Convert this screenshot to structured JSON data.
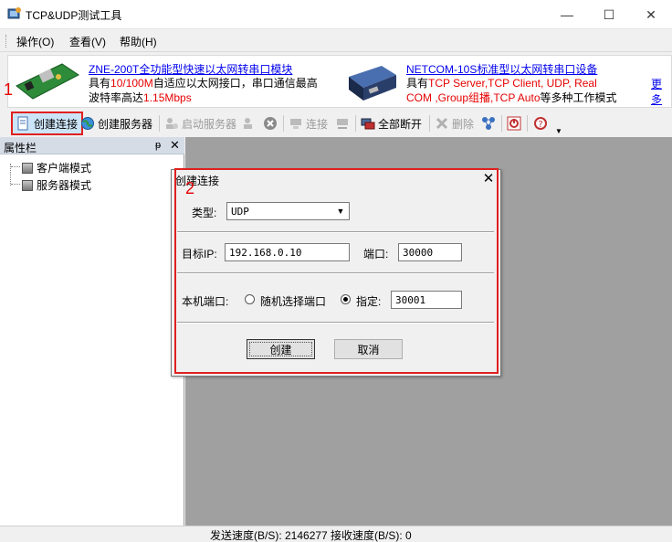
{
  "window": {
    "title": "TCP&UDP测试工具",
    "min": "—",
    "max": "☐",
    "close": "✕"
  },
  "menu": {
    "items": [
      "操作(O)",
      "查看(V)",
      "帮助(H)"
    ]
  },
  "banner": {
    "product1": {
      "title": "ZNE-200T全功能型快速以太网转串口模块",
      "line1_a": "具有",
      "line1_b": "10/100M",
      "line1_c": "自适应以太网接口，串口通信最高",
      "line2_a": "波特率高达",
      "line2_b": "1.15Mbps"
    },
    "product2": {
      "title": "NETCOM-10S标准型以太网转串口设备",
      "line1_a": "具有",
      "line1_b": "TCP Server,TCP Client, UDP, Real",
      "line2_a": "COM ,Group组播,TCP Auto",
      "line2_b": "等多种工作模式"
    },
    "more": "更多"
  },
  "annotations": {
    "num1": "1",
    "num2": "2"
  },
  "toolbar": {
    "create_connection": "创建连接",
    "create_server": "创建服务器",
    "start_server": "启动服务器",
    "connect": "连接",
    "disconnect_all": "全部断开",
    "delete": "删除"
  },
  "left_panel": {
    "title": "属性栏",
    "pin": "ᵽ",
    "close": "✕",
    "tree": [
      "客户端模式",
      "服务器模式"
    ]
  },
  "dialog": {
    "title": "创建连接",
    "close": "✕",
    "type_label": "类型:",
    "type_value": "UDP",
    "target_ip_label": "目标IP:",
    "target_ip_value": "192.168.0.10",
    "port_label": "端口:",
    "port_value": "30000",
    "local_port_label": "本机端口:",
    "random_port_label": "随机选择端口",
    "specify_label": "指定:",
    "local_port_value": "30001",
    "create_button": "创建",
    "cancel_button": "取消"
  },
  "status": {
    "text": "发送速度(B/S): 2146277 接收速度(B/S): 0"
  },
  "colors": {
    "highlight_red": "#e02020",
    "banner_red": "#e60000",
    "link_blue": "#0000ee",
    "main_grey": "#a0a0a0"
  }
}
